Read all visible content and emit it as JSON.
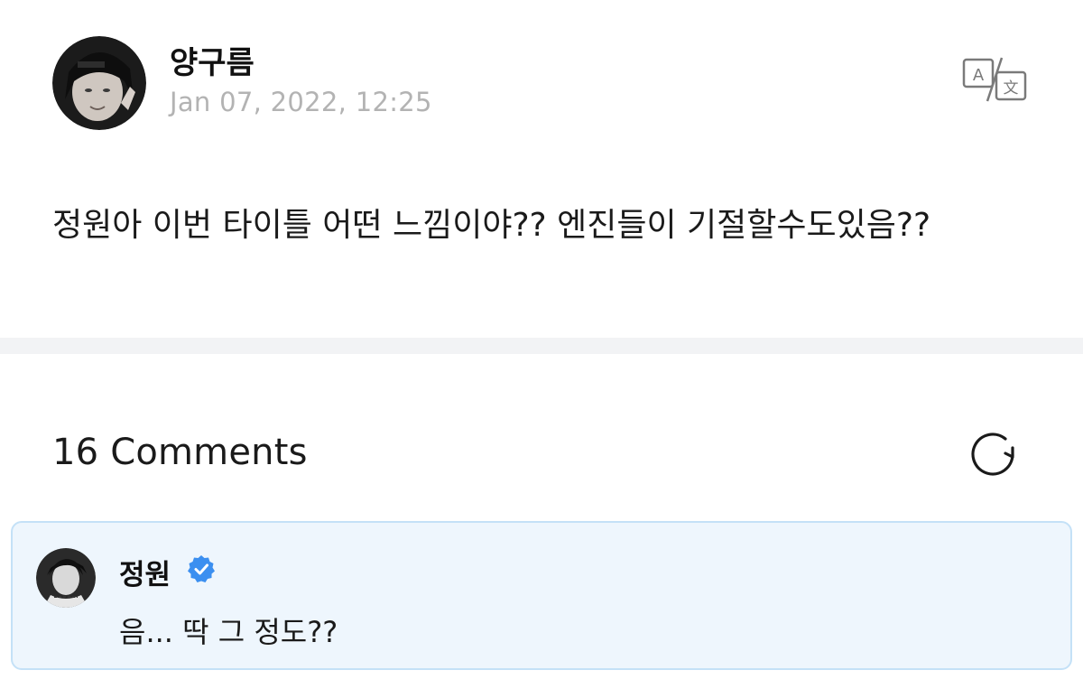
{
  "post": {
    "author": "양구름",
    "timestamp": "Jan 07, 2022, 12:25",
    "body": "정원아 이번 타이틀 어떤 느낌이야?? 엔진들이 기절할수도있음??",
    "translate_icon": "translate-icon"
  },
  "comments": {
    "count_label": "16 Comments",
    "refresh_icon": "refresh-icon",
    "items": [
      {
        "author": "정원",
        "verified": true,
        "text": "음...  딱 그 정도??"
      }
    ]
  },
  "colors": {
    "highlight_bg": "#eef6fd",
    "highlight_border": "#c4e1f7",
    "verified": "#3b8ff0",
    "muted_text": "#b3b3b3"
  }
}
